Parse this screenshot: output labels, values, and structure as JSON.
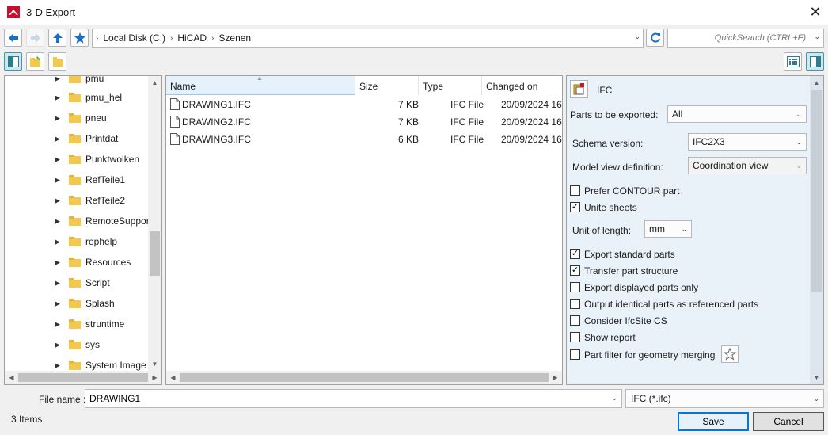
{
  "window": {
    "title": "3-D Export",
    "close_glyph": "✕"
  },
  "nav": {
    "back_icon": "arrow-left-icon",
    "forward_icon": "arrow-right-icon",
    "up_icon": "arrow-up-icon",
    "favorites_icon": "star-icon",
    "breadcrumb": [
      "Local Disk (C:)",
      "HiCAD",
      "Szenen"
    ],
    "refresh_icon": "refresh-icon",
    "search_placeholder": "QuickSearch (CTRL+F)"
  },
  "tree": {
    "items": [
      "pmu",
      "pmu_hel",
      "pneu",
      "Printdat",
      "Punktwolken",
      "RefTeile1",
      "RefTeile2",
      "RemoteSupport",
      "rephelp",
      "Resources",
      "Script",
      "Splash",
      "struntime",
      "sys",
      "System Image"
    ]
  },
  "files": {
    "columns": [
      "Name",
      "Size",
      "Type",
      "Changed on"
    ],
    "rows": [
      {
        "name": "DRAWING1.IFC",
        "size": "7 KB",
        "type": "IFC File",
        "changed": "20/09/2024 16"
      },
      {
        "name": "DRAWING2.IFC",
        "size": "7 KB",
        "type": "IFC File",
        "changed": "20/09/2024 16"
      },
      {
        "name": "DRAWING3.IFC",
        "size": "6 KB",
        "type": "IFC File",
        "changed": "20/09/2024 16"
      }
    ]
  },
  "props": {
    "header": "IFC",
    "parts_label": "Parts to be exported:",
    "parts_value": "All",
    "schema_label": "Schema version:",
    "schema_value": "IFC2X3",
    "mvd_label": "Model view definition:",
    "mvd_value": "Coordination view",
    "prefer_contour": {
      "label": "Prefer CONTOUR part",
      "checked": false
    },
    "unite_sheets": {
      "label": "Unite sheets",
      "checked": true
    },
    "unit_label": "Unit of length:",
    "unit_value": "mm",
    "checks": [
      {
        "label": "Export standard parts",
        "checked": true
      },
      {
        "label": "Transfer part structure",
        "checked": true
      },
      {
        "label": "Export displayed parts only",
        "checked": false
      },
      {
        "label": "Output identical parts as referenced parts",
        "checked": false
      },
      {
        "label": "Consider IfcSite CS",
        "checked": false
      },
      {
        "label": "Show report",
        "checked": false
      },
      {
        "label": "Part filter for geometry merging",
        "checked": false
      }
    ]
  },
  "bottom": {
    "filename_label": "File name :",
    "filename_value": "DRAWING1",
    "filetype": "IFC (*.ifc)",
    "items_count": "3  Items",
    "save_label": "Save",
    "cancel_label": "Cancel"
  },
  "colors": {
    "accent": "#0078d7",
    "panel_bg": "#e9f1f9",
    "folder": "#f3c84e"
  }
}
